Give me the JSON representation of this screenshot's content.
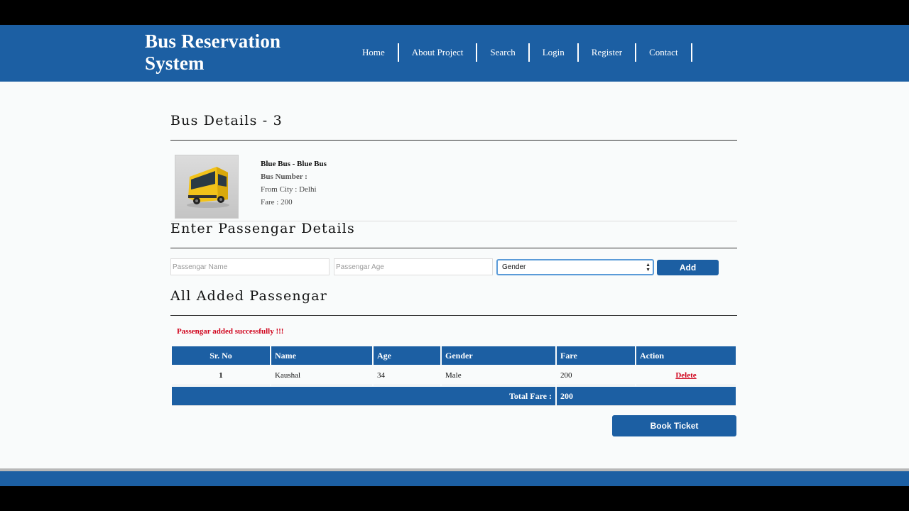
{
  "app": {
    "title": "Bus Reservation System"
  },
  "nav": {
    "items": [
      "Home",
      "About Project",
      "Search",
      "Login",
      "Register",
      "Contact"
    ]
  },
  "bus": {
    "heading": "Bus Details - 3",
    "name": "Blue Bus - Blue Bus",
    "number_label": "Bus Number :",
    "from_city": "From City : Delhi",
    "fare": "Fare : 200"
  },
  "passenger_form": {
    "heading": "Enter Passengar Details",
    "name_placeholder": "Passengar Name",
    "age_placeholder": "Passengar Age",
    "gender_selected": "Gender",
    "add_label": "Add"
  },
  "passengers": {
    "heading": "All Added Passengar",
    "message": "Passengar added successfully !!!",
    "columns": [
      "Sr. No",
      "Name",
      "Age",
      "Gender",
      "Fare",
      "Action"
    ],
    "rows": [
      {
        "sr": "1",
        "name": "Kaushal",
        "age": "34",
        "gender": "Male",
        "fare": "200",
        "action": "Delete"
      }
    ],
    "total_label": "Total Fare :",
    "total_value": "200"
  },
  "book": {
    "label": "Book Ticket"
  },
  "colors": {
    "brand": "#1c5fa3",
    "error": "#d0021b"
  }
}
